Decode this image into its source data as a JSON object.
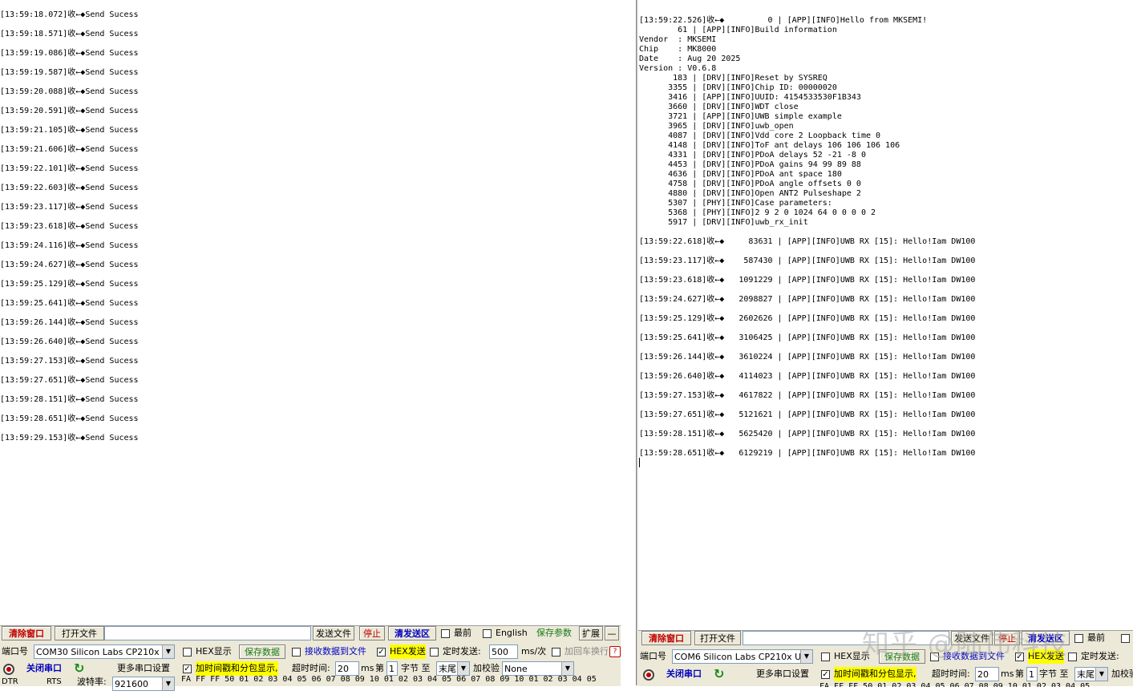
{
  "left_log": [
    "[13:59:18.072]收←◆Send Sucess",
    "[13:59:18.571]收←◆Send Sucess",
    "[13:59:19.086]收←◆Send Sucess",
    "[13:59:19.587]收←◆Send Sucess",
    "[13:59:20.088]收←◆Send Sucess",
    "[13:59:20.591]收←◆Send Sucess",
    "[13:59:21.105]收←◆Send Sucess",
    "[13:59:21.606]收←◆Send Sucess",
    "[13:59:22.101]收←◆Send Sucess",
    "[13:59:22.603]收←◆Send Sucess",
    "[13:59:23.117]收←◆Send Sucess",
    "[13:59:23.618]收←◆Send Sucess",
    "[13:59:24.116]收←◆Send Sucess",
    "[13:59:24.627]收←◆Send Sucess",
    "[13:59:25.129]收←◆Send Sucess",
    "[13:59:25.641]收←◆Send Sucess",
    "[13:59:26.144]收←◆Send Sucess",
    "[13:59:26.640]收←◆Send Sucess",
    "[13:59:27.153]收←◆Send Sucess",
    "[13:59:27.651]收←◆Send Sucess",
    "[13:59:28.151]收←◆Send Sucess",
    "[13:59:28.651]收←◆Send Sucess",
    "[13:59:29.153]收←◆Send Sucess"
  ],
  "right_boot_log": [
    "[13:59:22.526]收←◆         0 | [APP][INFO]Hello from MKSEMI!",
    "        61 | [APP][INFO]Build information",
    "Vendor  : MKSEMI",
    "Chip    : MK8000",
    "Date    : Aug 20 2025",
    "Version : V0.6.8",
    "       183 | [DRV][INFO]Reset by SYSREQ",
    "      3355 | [DRV][INFO]Chip ID: 00000020",
    "      3416 | [APP][INFO]UUID: 4154533530F1B343",
    "      3660 | [DRV][INFO]WDT close",
    "      3721 | [APP][INFO]UWB simple example",
    "      3965 | [DRV][INFO]uwb_open",
    "      4087 | [DRV][INFO]Vdd core 2 Loopback time 0",
    "      4148 | [DRV][INFO]ToF ant delays 106 106 106 106",
    "      4331 | [DRV][INFO]PDoA delays 52 -21 -8 0",
    "      4453 | [DRV][INFO]PDoA gains 94 99 89 88",
    "      4636 | [DRV][INFO]PDoA ant space 180",
    "      4758 | [DRV][INFO]PDoA angle offsets 0 0",
    "      4880 | [DRV][INFO]Open ANT2 Pulseshape 2",
    "      5307 | [PHY][INFO]Case parameters:",
    "      5368 | [PHY][INFO]2 9 2 0 1024 64 0 0 0 0 2",
    "      5917 | [DRV][INFO]uwb_rx_init"
  ],
  "right_rx_log": [
    "[13:59:22.618]收←◆     83631 | [APP][INFO]UWB RX [15]: Hello!Iam DW100",
    "[13:59:23.117]收←◆    587430 | [APP][INFO]UWB RX [15]: Hello!Iam DW100",
    "[13:59:23.618]收←◆   1091229 | [APP][INFO]UWB RX [15]: Hello!Iam DW100",
    "[13:59:24.627]收←◆   2098827 | [APP][INFO]UWB RX [15]: Hello!Iam DW100",
    "[13:59:25.129]收←◆   2602626 | [APP][INFO]UWB RX [15]: Hello!Iam DW100",
    "[13:59:25.641]收←◆   3106425 | [APP][INFO]UWB RX [15]: Hello!Iam DW100",
    "[13:59:26.144]收←◆   3610224 | [APP][INFO]UWB RX [15]: Hello!Iam DW100",
    "[13:59:26.640]收←◆   4114023 | [APP][INFO]UWB RX [15]: Hello!Iam DW100",
    "[13:59:27.153]收←◆   4617822 | [APP][INFO]UWB RX [15]: Hello!Iam DW100",
    "[13:59:27.651]收←◆   5121621 | [APP][INFO]UWB RX [15]: Hello!Iam DW100",
    "[13:59:28.151]收←◆   5625420 | [APP][INFO]UWB RX [15]: Hello!Iam DW100",
    "[13:59:28.651]收←◆   6129219 | [APP][INFO]UWB RX [15]: Hello!Iam DW100"
  ],
  "left_ctrl": {
    "clear_window": "清除窗口",
    "open_file": "打开文件",
    "send_file": "发送文件",
    "stop": "停止",
    "clear_send": "清发送区",
    "topmost": "最前",
    "english": "English",
    "save_params": "保存参数",
    "expand": "扩展",
    "minus": "—",
    "port_label": "端口号",
    "port_value": "COM30 Silicon Labs CP210x",
    "hex_display": "HEX显示",
    "save_data": "保存数据",
    "recv_to_file": "接收数据到文件",
    "hex_send": "HEX发送",
    "timed_send": "定时发送:",
    "interval": "500",
    "interval_unit": "ms/次",
    "add_crlf": "加回车换行",
    "close_port": "关闭串口",
    "more_settings": "更多串口设置",
    "timestamp": "加时间戳和分包显示,",
    "timeout_label": "超时时间:",
    "timeout": "20",
    "ms": "ms",
    "nth": "第",
    "nth_value": "1",
    "byte_label": "字节 至",
    "end_value": "末尾",
    "checksum": "加校验",
    "checksum_value": "None",
    "dtr": "DTR",
    "rts": "RTS",
    "baud_label": "波特率:",
    "baud": "921600",
    "hex_data": "FA FF FF 50 01 02 03 04 05 06 07 08 09 10 01 02 03 04 05 06 07 08 09 10 01 02 03 04 05"
  },
  "right_ctrl": {
    "clear_window": "清除窗口",
    "open_file": "打开文件",
    "send_file": "发送文件",
    "stop": "停止",
    "clear_send": "清发送区",
    "topmost": "最前",
    "port_label": "端口号",
    "port_value": "COM6 Silicon Labs CP210x U",
    "hex_display": "HEX显示",
    "save_data": "保存数据",
    "recv_to_file": "接收数据到文件",
    "hex_send": "HEX发送",
    "timed_send": "定时发送:",
    "close_port": "关闭串口",
    "more_settings": "更多串口设置",
    "timestamp": "加时间戳和分包显示,",
    "timeout_label": "超时时间:",
    "timeout": "20",
    "ms": "ms",
    "nth": "第",
    "nth_value": "1",
    "byte_label": "字节 至",
    "end_value": "末尾",
    "checksum": "加校验",
    "hex_data": "FA FF FF 50 01 02 03 04 05 06 07 08 09 10 01 02 03 04 05"
  },
  "watermark": "知乎 @陆伟科技",
  "colors": {
    "close_port_icon": "#c00000",
    "refresh_icon": "#1a8a1a",
    "highlight": "#ffff00"
  }
}
